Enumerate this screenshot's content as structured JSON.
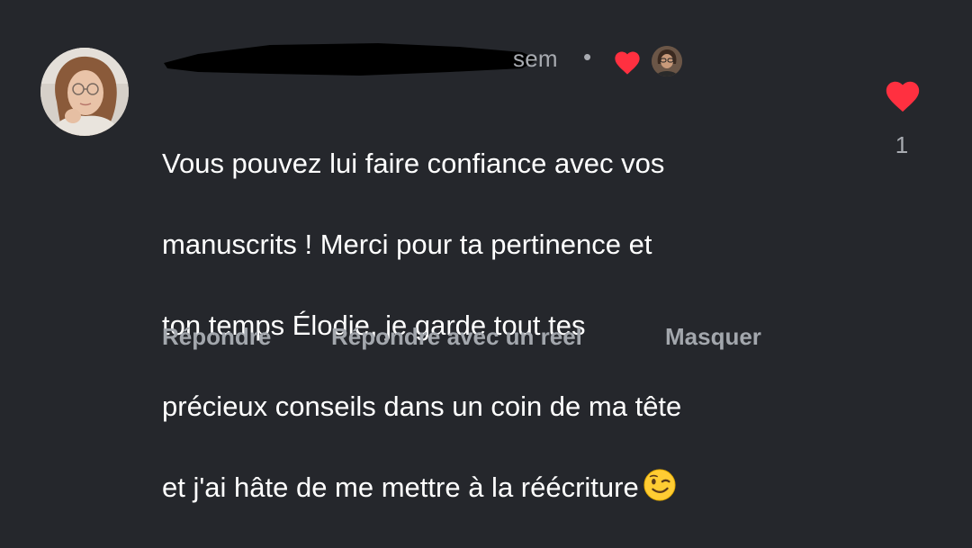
{
  "comment": {
    "author_redacted": true,
    "time": "sem",
    "separator": "•",
    "text_lines": [
      "Vous pouvez lui faire confiance avec vos",
      "manuscrits ! Merci pour ta pertinence et",
      "ton temps Élodie, je garde tout tes",
      "précieux conseils dans un coin de ma tête",
      "et j'ai hâte de me mettre à la réécriture"
    ],
    "emoji": "winking-face",
    "like_count": "1",
    "actions": {
      "reply": "Répondre",
      "reply_reel": "Répondre avec un reel",
      "hide": "Masquer"
    }
  },
  "colors": {
    "background": "#25272c",
    "text": "#ffffff",
    "muted": "#a3a7ad",
    "heart": "#ff3040"
  }
}
